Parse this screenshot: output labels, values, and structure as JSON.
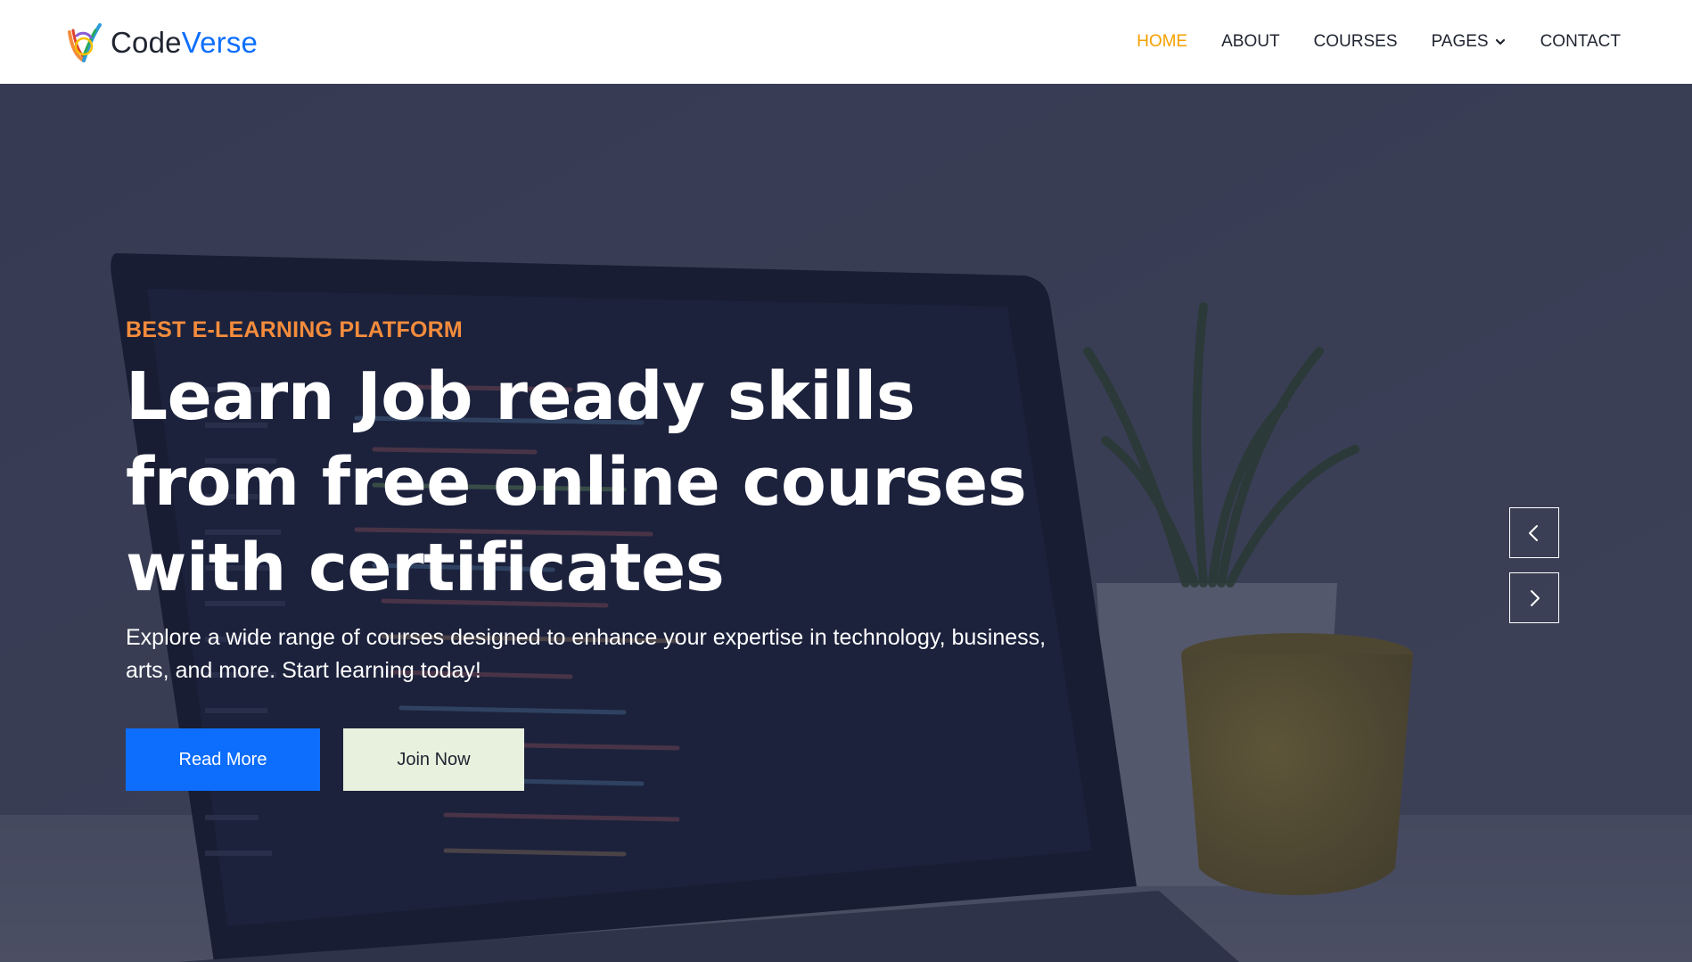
{
  "brand": {
    "name_part1": "Code",
    "name_part2": "Verse",
    "accent_color": "#0d6efd"
  },
  "nav": {
    "items": [
      {
        "label": "HOME",
        "active": true
      },
      {
        "label": "ABOUT",
        "active": false
      },
      {
        "label": "COURSES",
        "active": false
      },
      {
        "label": "PAGES",
        "active": false,
        "has_dropdown": true
      },
      {
        "label": "CONTACT",
        "active": false
      }
    ],
    "active_color": "#f5a000"
  },
  "hero": {
    "eyebrow": "BEST E-LEARNING PLATFORM",
    "headline": "Learn Job ready skills from free online courses with certificates",
    "subtext": "Explore a wide range of courses designed to enhance your expertise in technology, business, arts, and more. Start learning today!",
    "primary_cta": "Read More",
    "secondary_cta": "Join Now",
    "background_icon": "laptop-with-code-and-plant-photo",
    "eyebrow_color": "#f48c3c"
  },
  "carousel": {
    "prev_icon": "chevron-left-icon",
    "next_icon": "chevron-right-icon"
  }
}
